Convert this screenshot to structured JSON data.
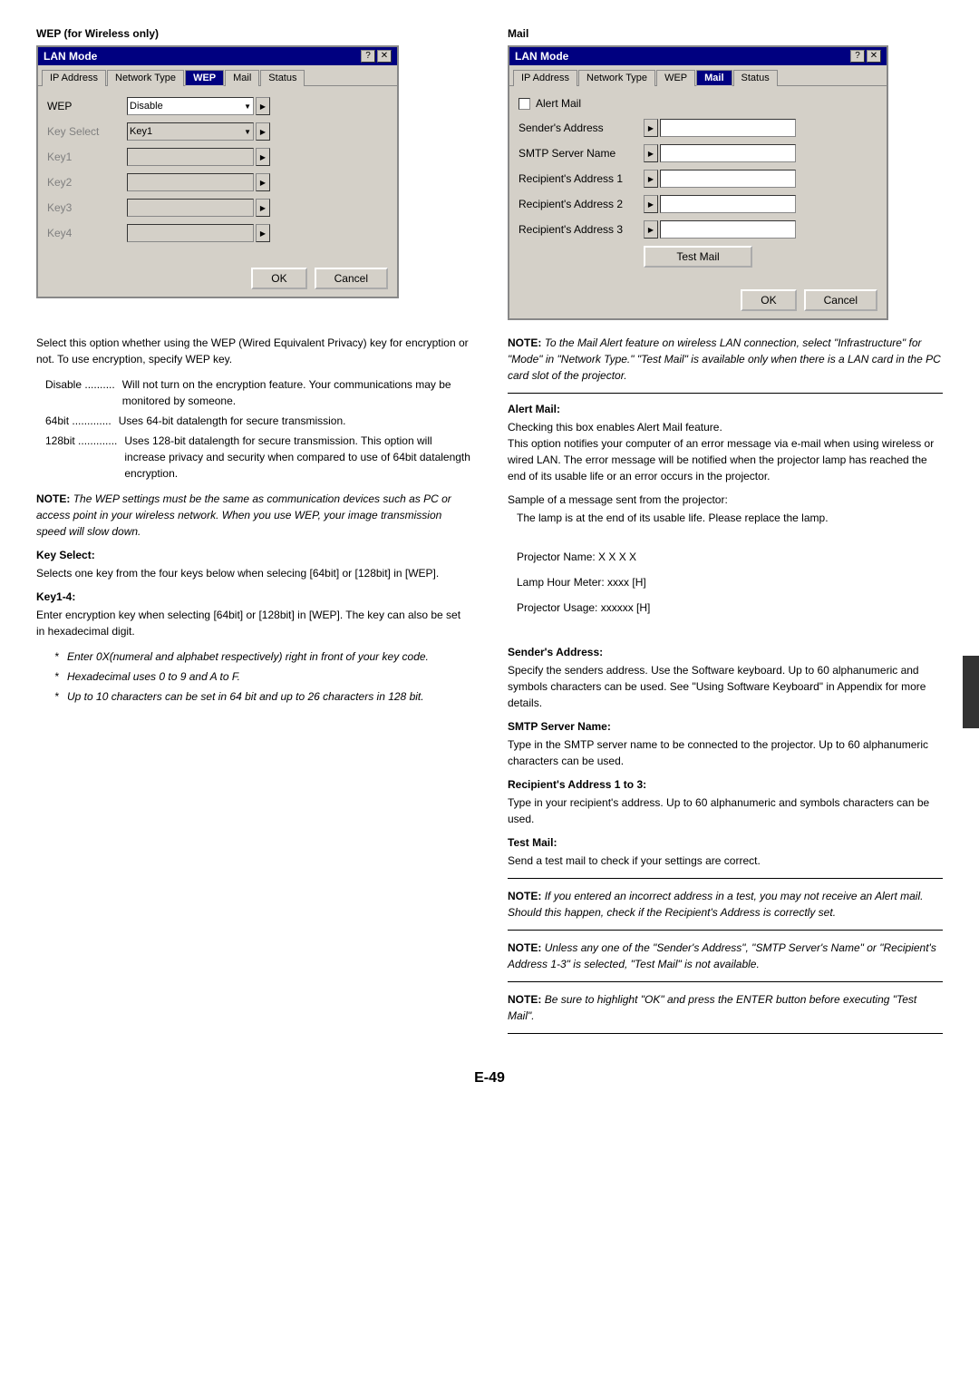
{
  "left_section": {
    "title": "WEP (for Wireless only)",
    "dialog": {
      "titlebar": "LAN Mode",
      "tabs": [
        "IP Address",
        "Network Type",
        "WEP",
        "Mail",
        "Status"
      ],
      "active_tab": "WEP",
      "fields": [
        {
          "label": "WEP",
          "value": "Disable",
          "type": "dropdown",
          "active": true
        },
        {
          "label": "Key Select",
          "value": "Key1",
          "type": "dropdown",
          "active": false
        },
        {
          "label": "Key1",
          "value": "",
          "type": "input",
          "active": false
        },
        {
          "label": "Key2",
          "value": "",
          "type": "input",
          "active": false
        },
        {
          "label": "Key3",
          "value": "",
          "type": "input",
          "active": false
        },
        {
          "label": "Key4",
          "value": "",
          "type": "input",
          "active": false
        }
      ],
      "ok_label": "OK",
      "cancel_label": "Cancel"
    },
    "description": "Select this option whether using the WEP (Wired Equivalent Privacy) key for encryption or not. To use encryption, specify WEP key.",
    "options": [
      {
        "key": "Disable",
        "dots": "..........",
        "desc": "Will not turn on the encryption feature. Your communications may be monitored by someone."
      },
      {
        "key": "64bit",
        "dots": ".............",
        "desc": "Uses 64-bit datalength for secure transmission."
      },
      {
        "key": "128bit",
        "dots": ".............",
        "desc": "Uses 128-bit datalength for secure transmission. This option will increase privacy and security when compared to use of 64bit datalength encryption."
      }
    ],
    "note": "NOTE: The WEP settings must be the same as communication devices such as PC or access point in your wireless network. When you use WEP, your image transmission speed will slow down.",
    "key_select_title": "Key Select:",
    "key_select_desc": "Selects one key from the four keys below when selecing [64bit] or [128bit] in [WEP].",
    "key14_title": "Key1-4:",
    "key14_desc": "Enter encryption key when selecting [64bit] or [128bit] in [WEP]. The key can also be set in hexadecimal digit.",
    "bullets": [
      "Enter 0X(numeral and alphabet respectively) right in front of your key code.",
      "Hexadecimal uses 0 to 9 and A to F.",
      "Up to 10 characters can be set in 64 bit and up to 26 characters in 128 bit."
    ]
  },
  "right_section": {
    "title": "Mail",
    "dialog": {
      "titlebar": "LAN Mode",
      "tabs": [
        "IP Address",
        "Network Type",
        "WEP",
        "Mail",
        "Status"
      ],
      "active_tab": "Mail",
      "alert_mail_label": "Alert Mail",
      "fields": [
        {
          "label": "Sender's Address",
          "value": ""
        },
        {
          "label": "SMTP Server Name",
          "value": ""
        },
        {
          "label": "Recipient's Address 1",
          "value": ""
        },
        {
          "label": "Recipient's Address 2",
          "value": ""
        },
        {
          "label": "Recipient's Address 3",
          "value": ""
        }
      ],
      "test_mail_label": "Test Mail",
      "ok_label": "OK",
      "cancel_label": "Cancel"
    },
    "note1": "NOTE: To the Mail Alert feature on wireless LAN connection, select \"Infrastructure\" for \"Mode\" in \"Network Type.\" \"Test Mail\" is available only when there is a LAN card in the PC card slot of the projector.",
    "alert_mail_title": "Alert Mail:",
    "alert_mail_desc": "Checking this box enables Alert Mail feature.\nThis option notifies your computer of an error message via e-mail when using wireless or wired LAN. The error message will be notified when the projector lamp has reached the end of its usable life or an error occurs in the projector.",
    "sample_title": "Sample of a message sent from the projector:",
    "sample_lines": [
      "The lamp is at the end of its usable life. Please replace the lamp.",
      "",
      "Projector Name: X X X X",
      "Lamp Hour Meter: xxxx [H]",
      "Projector Usage: xxxxxx [H]"
    ],
    "senders_title": "Sender's Address:",
    "senders_desc": "Specify the senders address. Use the Software keyboard. Up to 60 alphanumeric and symbols characters can be used. See \"Using Software Keyboard\" in Appendix for more details.",
    "smtp_title": "SMTP Server Name:",
    "smtp_desc": "Type in the SMTP server name to be connected to the projector. Up to 60 alphanumeric characters can be used.",
    "recipient_title": "Recipient's Address 1 to 3:",
    "recipient_desc": "Type in your recipient's address. Up to 60 alphanumeric and symbols characters can be used.",
    "test_mail_section_title": "Test Mail:",
    "test_mail_desc": "Send a test mail to check if your settings are correct.",
    "note2": "NOTE: If you entered an incorrect address in a test, you may not receive an Alert mail. Should this happen, check if the Recipient's Address is correctly set.",
    "note3": "NOTE: Unless any one of the \"Sender's Address\", \"SMTP Server's Name\" or \"Recipient's Address 1-3\" is selected, \"Test Mail\" is not available.",
    "note4": "NOTE: Be sure to highlight \"OK\" and press the ENTER button before executing \"Test Mail\"."
  },
  "page_number": "E-49"
}
